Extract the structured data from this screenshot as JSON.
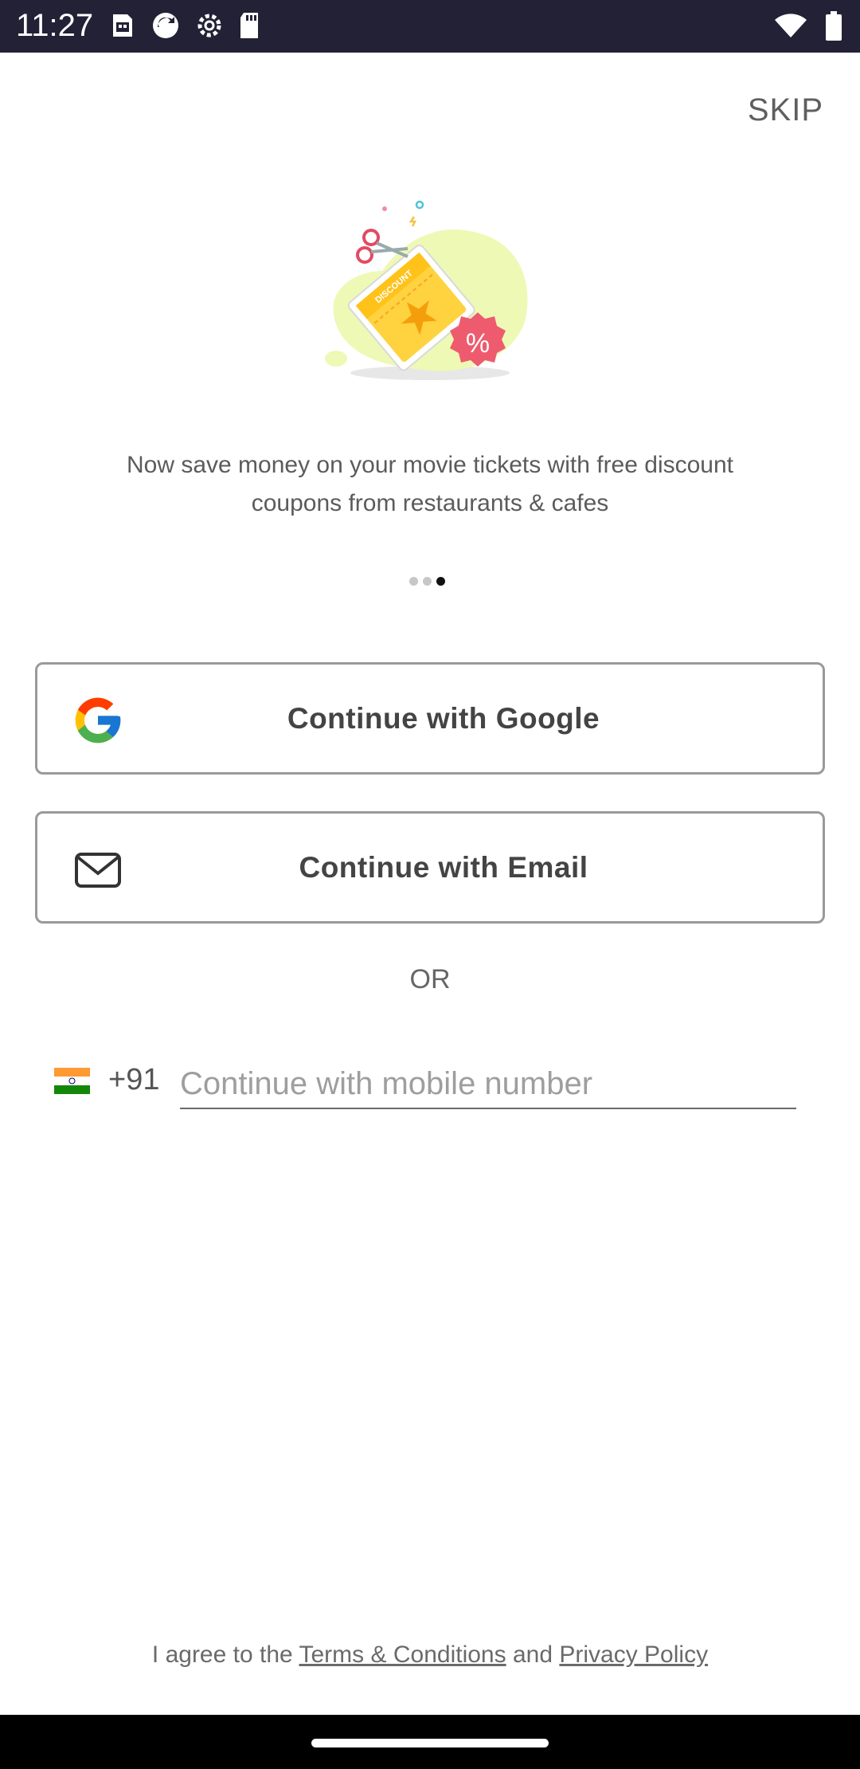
{
  "status_bar": {
    "time": "11:27",
    "icons": [
      "sd-card-calendar-icon",
      "sync-icon",
      "settings-icon",
      "sd-card-icon",
      "wifi-icon",
      "battery-icon"
    ]
  },
  "header": {
    "skip_label": "SKIP"
  },
  "onboarding": {
    "illustration": "discount-coupon-illustration",
    "tagline_line1": "Now save money on your movie tickets with free discount",
    "tagline_line2": "coupons from restaurants & cafes",
    "pagination": {
      "total": 3,
      "active_index": 2
    }
  },
  "auth": {
    "google_label": "Continue with Google",
    "email_label": "Continue with Email",
    "or_label": "OR",
    "country_code": "+91",
    "country_flag": "india-flag-icon",
    "mobile_placeholder": "Continue with mobile number",
    "mobile_value": ""
  },
  "legal": {
    "prefix": "I agree to the",
    "terms_link": "Terms & Conditions",
    "joiner": "and",
    "privacy_link": "Privacy Policy"
  },
  "colors": {
    "status_bar_bg": "#232136",
    "coupon_yellow": "#FFD23F",
    "badge_pink": "#EF5B6E",
    "blob_green": "#EEF9B5",
    "button_border": "#9a9a9a"
  }
}
